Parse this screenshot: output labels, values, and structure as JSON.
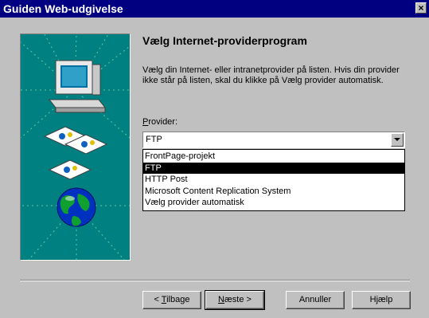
{
  "window": {
    "title": "Guiden Web-udgivelse",
    "close_glyph": "×"
  },
  "page": {
    "heading": "Vælg Internet-providerprogram",
    "description": "Vælg din Internet- eller intranetprovider på listen. Hvis din provider ikke står på listen, skal du klikke på Vælg provider automatisk."
  },
  "provider": {
    "label_mnemonic": "P",
    "label_rest": "rovider:",
    "value": "FTP",
    "options": [
      "FrontPage-projekt",
      "FTP",
      "HTTP Post",
      "Microsoft Content Replication System",
      "Vælg provider automatisk"
    ],
    "selected_index": 1
  },
  "buttons": {
    "back_prefix": "< ",
    "back_mnemonic": "T",
    "back_rest": "ilbage",
    "next_mnemonic": "N",
    "next_rest": "æste >",
    "cancel": "Annuller",
    "help": "Hjælp"
  },
  "icons": {
    "wizard_art": "computer-documents-globe-illustration",
    "dropdown": "chevron-down-icon",
    "close": "close-icon"
  },
  "colors": {
    "titlebar": "#000080",
    "panel": "#008080",
    "face": "#c0c0c0",
    "selection": "#000000"
  }
}
